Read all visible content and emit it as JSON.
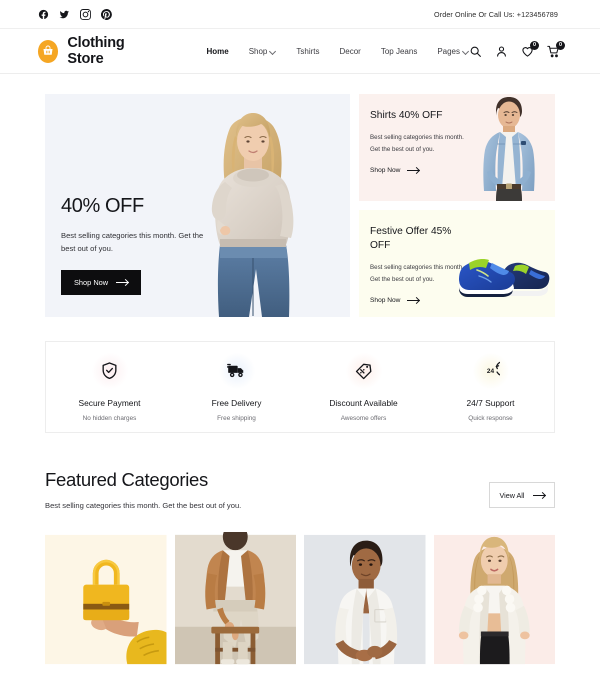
{
  "topbar": {
    "social": [
      {
        "name": "facebook-icon",
        "label": "Facebook"
      },
      {
        "name": "twitter-icon",
        "label": "Twitter"
      },
      {
        "name": "instagram-icon",
        "label": "Instagram"
      },
      {
        "name": "pinterest-icon",
        "label": "Pinterest"
      }
    ],
    "call_text": "Order Online Or Call Us: +123456789"
  },
  "header": {
    "brand_name": "Clothing Store",
    "brand_icon": "shopping-basket-icon",
    "nav": [
      {
        "label": "Home",
        "has_dropdown": false,
        "active": true
      },
      {
        "label": "Shop",
        "has_dropdown": true,
        "active": false
      },
      {
        "label": "Tshirts",
        "has_dropdown": false,
        "active": false
      },
      {
        "label": "Decor",
        "has_dropdown": false,
        "active": false
      },
      {
        "label": "Top Jeans",
        "has_dropdown": false,
        "active": false
      },
      {
        "label": "Pages",
        "has_dropdown": true,
        "active": false
      }
    ],
    "actions": {
      "search_icon": "search-icon",
      "account_icon": "user-icon",
      "wishlist_icon": "heart-icon",
      "wishlist_count": "0",
      "cart_icon": "cart-icon",
      "cart_count": "0"
    }
  },
  "hero": {
    "title": "40% OFF",
    "subtitle": "Best selling categories this month. Get the best out of you.",
    "button_label": "Shop Now",
    "background": "#f2f4f9"
  },
  "promos": [
    {
      "title": "Shirts 40% OFF",
      "subtitle": "Best selling categories this month. Get the best out of you.",
      "link_label": "Shop Now",
      "background": "#fbf1ee",
      "art": "man-in-denim-jacket"
    },
    {
      "title": "Festive Offer 45% OFF",
      "subtitle": "Best selling categories this month. Get the best out of you.",
      "link_label": "Shop Now",
      "background": "#fdfdef",
      "art": "blue-running-shoes"
    }
  ],
  "features": [
    {
      "icon": "shield-check-icon",
      "title": "Secure Payment",
      "desc": "No hidden charges",
      "tint": "pink"
    },
    {
      "icon": "delivery-truck-icon",
      "title": "Free Delivery",
      "desc": "Free shipping",
      "tint": "blue"
    },
    {
      "icon": "discount-tag-icon",
      "title": "Discount Available",
      "desc": "Awesome offers",
      "tint": "peach"
    },
    {
      "icon": "twentyfour-hours-icon",
      "title": "24/7 Support",
      "desc": "Quick response",
      "tint": "yellow"
    }
  ],
  "featured": {
    "title": "Featured Categories",
    "subtitle": "Best selling categories this month. Get the best out of you.",
    "view_all_label": "View All",
    "cards": [
      {
        "art": "yellow-handbag-in-hand",
        "background": "#fdf6e6"
      },
      {
        "art": "man-in-tan-blazer-seated",
        "background": "#e6e1d8"
      },
      {
        "art": "man-in-white-shirt",
        "background": "#e4e6ea"
      },
      {
        "art": "woman-in-white-fur-jacket",
        "background": "#fbece8"
      }
    ]
  },
  "colors": {
    "brand_orange": "#f5a623",
    "dark": "#15161a",
    "hero_bg": "#f2f4f9"
  }
}
